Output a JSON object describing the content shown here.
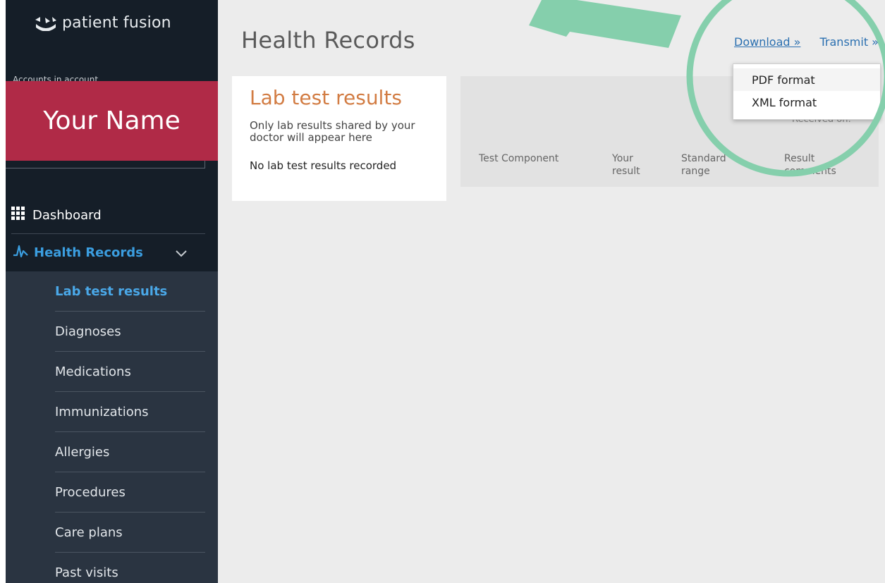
{
  "brand": {
    "name": "patient fusion",
    "logo_icon": "patient-fusion-logo-icon"
  },
  "account": {
    "label": "Accounts in account",
    "user_name": "Your Name"
  },
  "nav": {
    "dashboard": {
      "label": "Dashboard",
      "icon": "grid-icon"
    },
    "health_records": {
      "label": "Health Records",
      "icon": "pulse-icon",
      "expanded": true
    },
    "sub_items": [
      {
        "label": "Lab test results",
        "active": true
      },
      {
        "label": "Diagnoses",
        "active": false
      },
      {
        "label": "Medications",
        "active": false
      },
      {
        "label": "Immunizations",
        "active": false
      },
      {
        "label": "Allergies",
        "active": false
      },
      {
        "label": "Procedures",
        "active": false
      },
      {
        "label": "Care plans",
        "active": false
      },
      {
        "label": "Past visits",
        "active": false
      }
    ]
  },
  "main": {
    "title": "Health Records",
    "links": {
      "download": "Download »",
      "transmit": "Transmit »"
    },
    "dropdown": {
      "items": [
        "PDF format",
        "XML format"
      ]
    },
    "lab_card": {
      "title": "Lab test results",
      "subtitle": "Only lab results shared by your doctor will appear here",
      "empty_text": "No lab test results recorded"
    },
    "table": {
      "received_label": "Received on:",
      "columns": [
        "Test Component",
        "Your result",
        "Standard range",
        "Result comments"
      ]
    }
  },
  "colors": {
    "sidebar_top": "#151e28",
    "sidebar": "#2a3441",
    "name_box": "#b02a47",
    "accent_blue": "#3b9ee0",
    "lab_title": "#d27c43",
    "annotation_green": "#85cfac"
  }
}
